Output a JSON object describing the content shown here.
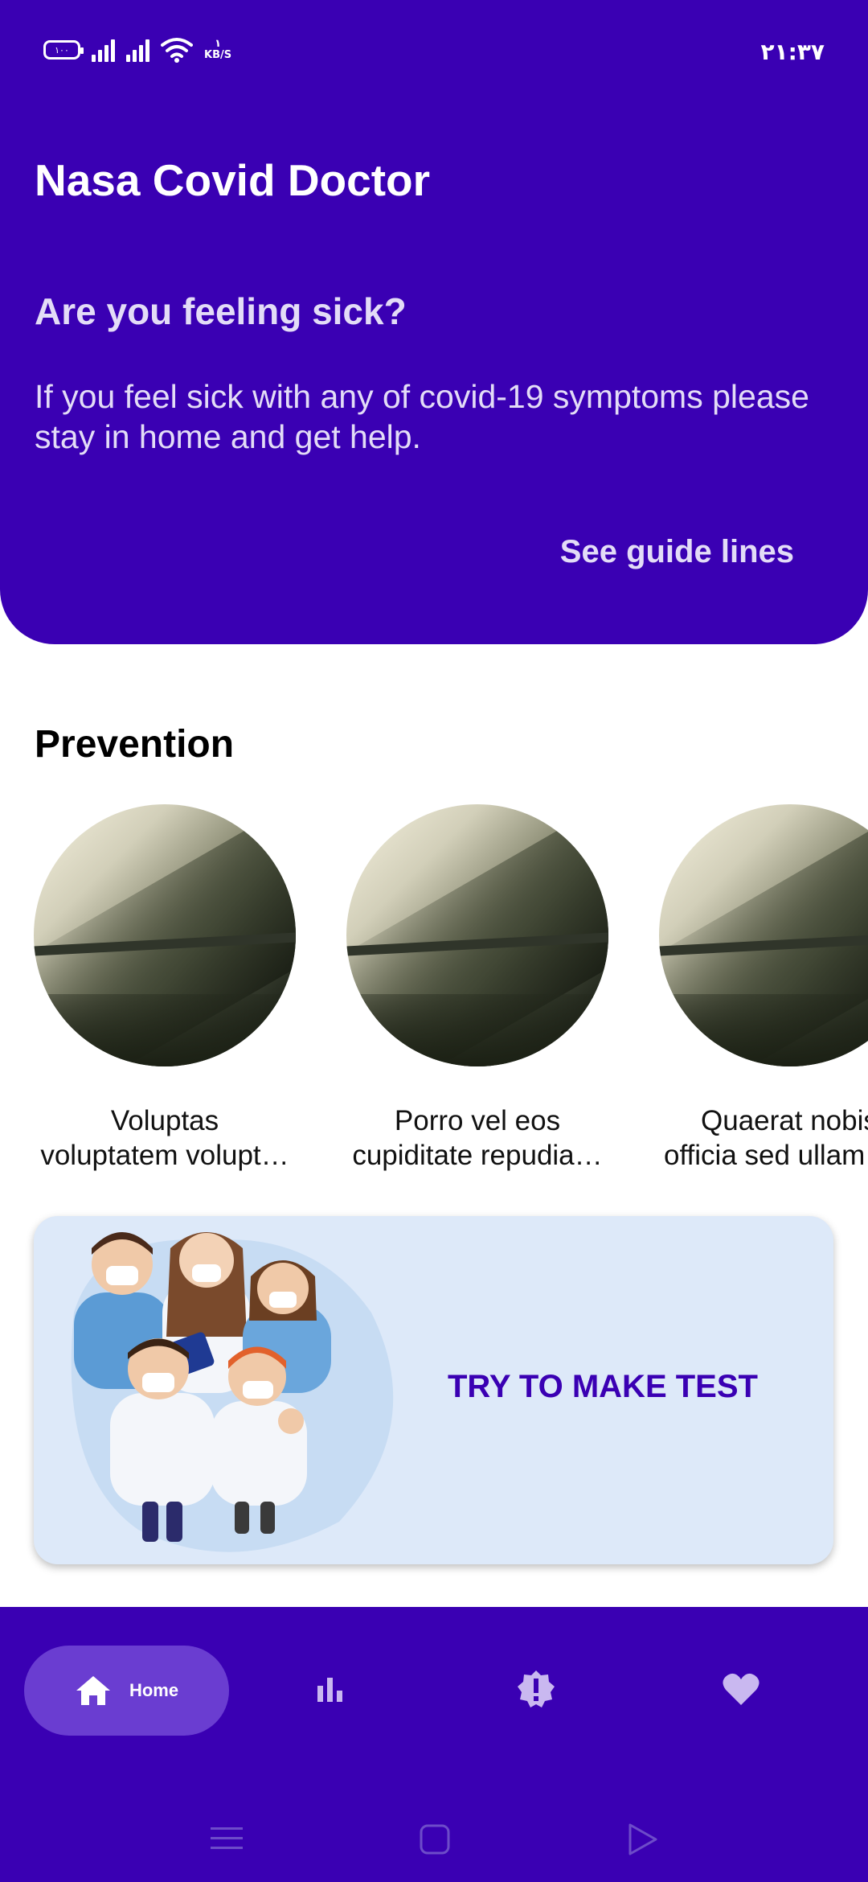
{
  "status_bar": {
    "battery": "١٠٠",
    "net_speed_value": "١",
    "net_speed_unit": "KB/S",
    "time": "٢١:٣٧"
  },
  "header": {
    "title": "Nasa Covid Doctor",
    "question": "Are you feeling sick?",
    "description": "If you feel sick with any of covid-19 symptoms please stay in home and get help.",
    "guide_link": "See guide lines"
  },
  "prevention": {
    "title": "Prevention",
    "items": [
      {
        "line1": "Voluptas",
        "line2": "voluptatem volupt…"
      },
      {
        "line1": "Porro vel eos",
        "line2": "cupiditate repudia…"
      },
      {
        "line1": "Quaerat nobis",
        "line2": "officia sed ullam"
      }
    ]
  },
  "test_banner": {
    "label": "TRY TO MAKE TEST"
  },
  "bottom_nav": {
    "home_label": "Home",
    "icons": [
      "home-icon",
      "bar-chart-icon",
      "alert-badge-icon",
      "heart-icon"
    ]
  },
  "colors": {
    "primary": "#3a00b3",
    "nav_active_pill": "#6a3dd1",
    "banner_bg": "#dde9f9",
    "muted_text": "#e3dcf7"
  }
}
